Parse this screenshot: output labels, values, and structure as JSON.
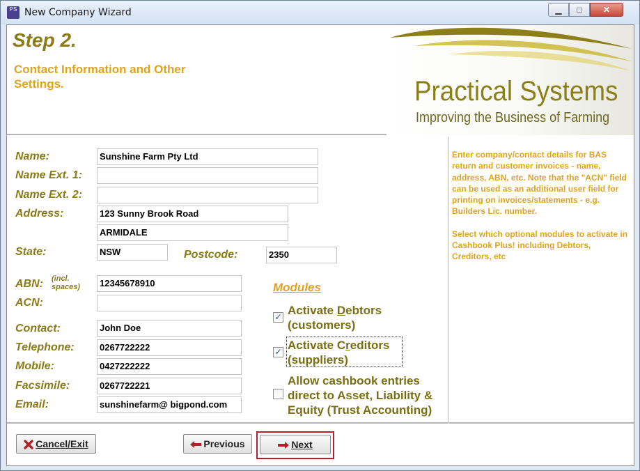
{
  "window": {
    "title": "New Company Wizard",
    "app_icon_text": "PS",
    "minimize_symbol": "▁",
    "maximize_symbol": "□",
    "close_symbol": "✕"
  },
  "header": {
    "step_title": "Step 2.",
    "step_subtitle": "Contact Information and Other Settings.",
    "logo_name": "Practical Systems",
    "logo_tagline": "Improving the Business of Farming"
  },
  "form": {
    "name_label": "Name:",
    "name_value": "Sunshine Farm Pty Ltd",
    "name_ext1_label": "Name Ext. 1:",
    "name_ext1_value": "",
    "name_ext2_label": "Name Ext. 2:",
    "name_ext2_value": "",
    "address_label": "Address:",
    "address_line1": "123 Sunny Brook Road",
    "address_line2": "ARMIDALE",
    "state_label": "State:",
    "state_value": "NSW",
    "postcode_label": "Postcode:",
    "postcode_value": "2350",
    "abn_label": "ABN:",
    "abn_note": "(incl. spaces)",
    "abn_value": "12345678910",
    "acn_label": "ACN:",
    "acn_value": "",
    "contact_label": "Contact:",
    "contact_value": "John Doe",
    "telephone_label": "Telephone:",
    "telephone_value": "0267722222",
    "mobile_label": "Mobile:",
    "mobile_value": "0427222222",
    "facsimile_label": "Facsimile:",
    "facsimile_value": "0267722221",
    "email_label": "Email:",
    "email_value": "sunshinefarm@ bigpond.com"
  },
  "modules": {
    "title": "Modules",
    "debtors_label": "Activate Debtors (customers)",
    "debtors_checked": true,
    "creditors_label": "Activate Creditors (suppliers)",
    "creditors_checked": true,
    "cashbook_label": "Allow cashbook entries direct to Asset, Liability & Equity (Trust Accounting)",
    "cashbook_checked": false,
    "check_mark": "✓"
  },
  "help": {
    "paragraph1": "Enter company/contact details for BAS return and customer invoices - name, address, ABN, etc. Note that the \"ACN\" field can be used as an additional user field for printing on invoices/statements - e.g. Builders Lic. number.",
    "paragraph2": "Select which optional modules to activate in Cashbook Plus! including Debtors, Creditors, etc"
  },
  "buttons": {
    "cancel_label": "Cancel/Exit",
    "previous_label": "Previous",
    "next_label": "Next"
  },
  "icons": {
    "cancel": "close-x-icon",
    "previous": "arrow-left-icon",
    "next": "arrow-right-icon",
    "accent_red": "#b3202a"
  },
  "colors": {
    "olive": "#8a7b16",
    "gold": "#e0a41c"
  }
}
